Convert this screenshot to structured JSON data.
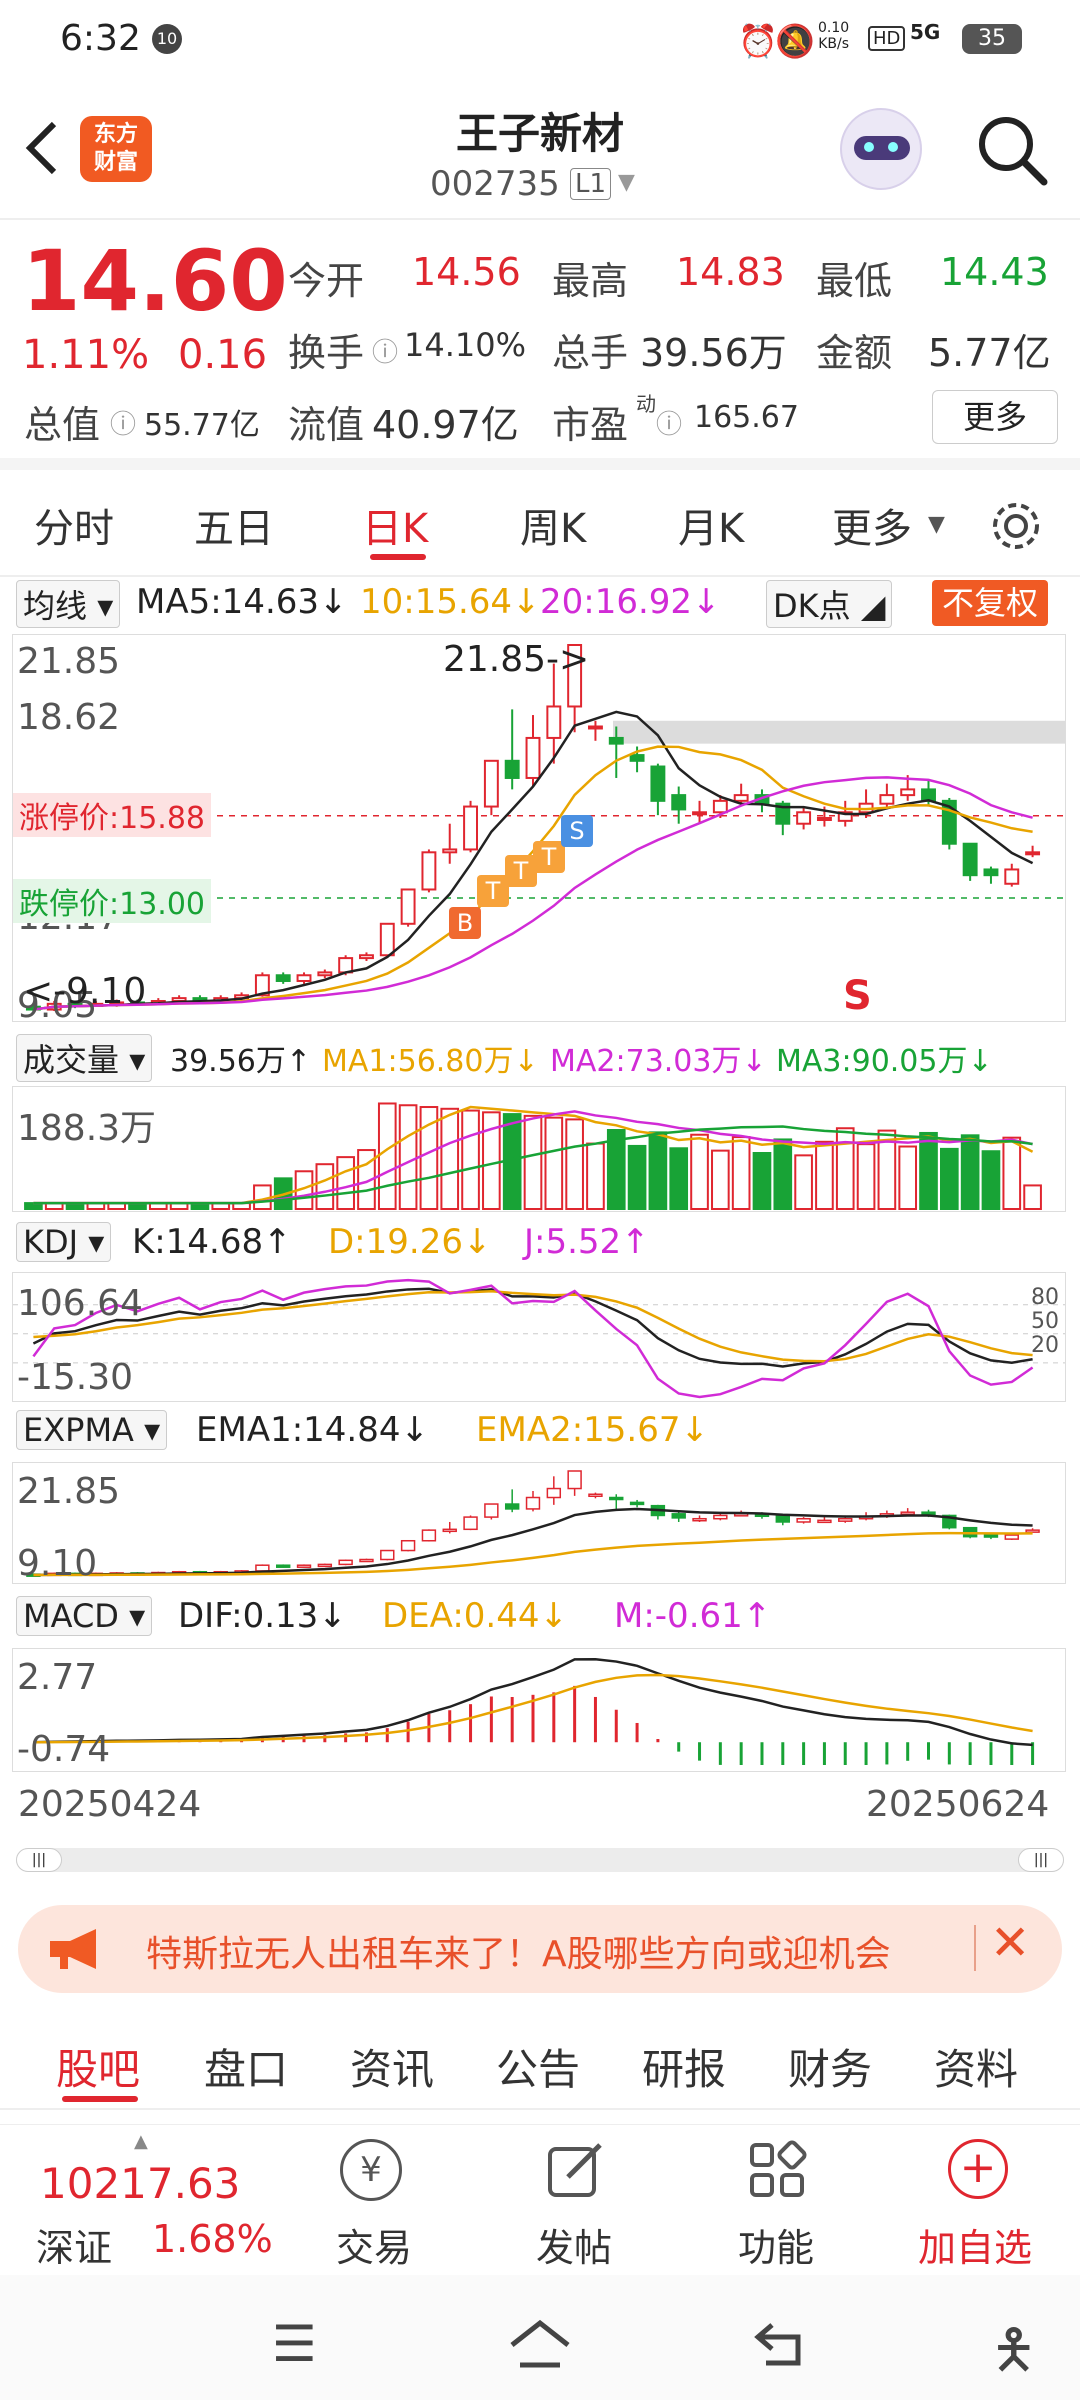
{
  "status_bar": {
    "time": "6:32",
    "notif_badge": "10",
    "net_speed": "0.10\nKB/s",
    "hd": "HD",
    "signal": "5G",
    "battery": "35"
  },
  "header": {
    "back_icon": "back-arrow-icon",
    "brand": "东方\n财富",
    "stock_name": "王子新材",
    "stock_code": "002735",
    "level": "L1",
    "search_icon": "search-icon"
  },
  "quote": {
    "price": "14.60",
    "change_pct": "1.11%",
    "change_amt": "0.16",
    "open_label": "今开",
    "open": "14.56",
    "high_label": "最高",
    "high": "14.83",
    "low_label": "最低",
    "low": "14.43",
    "turnover_label": "换手",
    "turnover": "14.10%",
    "volume_label": "总手",
    "volume": "39.56万",
    "amount_label": "金额",
    "amount": "5.77亿",
    "mktcap_label": "总值",
    "mktcap": "55.77亿",
    "float_label": "流值",
    "float": "40.97亿",
    "pe_label": "市盈",
    "pe_sup": "动",
    "pe": "165.67",
    "more_label": "更多"
  },
  "period_tabs": [
    "分时",
    "五日",
    "日K",
    "周K",
    "月K",
    "更多"
  ],
  "active_tab": "日K",
  "main_chart": {
    "ma_selector": "均线",
    "ma5": "MA5:14.63↓",
    "ma10": "10:15.64↓",
    "ma20": "20:16.92↓",
    "dk_label": "DK点",
    "fq_label": "不复权",
    "y_top": "21.85",
    "y_2": "18.62",
    "y_3": "12.17",
    "y_bottom": "9.05",
    "high_annot": "21.85->",
    "low_annot": "<-9.10",
    "limit_up": "涨停价:15.88",
    "limit_down": "跌停价:13.00",
    "s_marker": "S",
    "markers": [
      "B",
      "T",
      "T",
      "T",
      "S"
    ]
  },
  "volume_panel": {
    "selector": "成交量",
    "vol": "39.56万↑",
    "ma1": "MA1:56.80万↓",
    "ma2": "MA2:73.03万↓",
    "ma3": "MA3:90.05万↓",
    "y_top": "188.3万"
  },
  "kdj_panel": {
    "selector": "KDJ",
    "k": "K:14.68↑",
    "d": "D:19.26↓",
    "j": "J:5.52↑",
    "y_top": "106.64",
    "y_bottom": "-15.30",
    "levels": [
      "80",
      "50",
      "20"
    ]
  },
  "expma_panel": {
    "selector": "EXPMA",
    "ema1": "EMA1:14.84↓",
    "ema2": "EMA2:15.67↓",
    "y_top": "21.85",
    "y_bottom": "9.10"
  },
  "macd_panel": {
    "selector": "MACD",
    "dif": "DIF:0.13↓",
    "dea": "DEA:0.44↓",
    "m": "M:-0.61↑",
    "y_top": "2.77",
    "y_bottom": "-0.74"
  },
  "date_axis": {
    "start": "20250424",
    "end": "20250624"
  },
  "banner": {
    "text": "特斯拉无人出租车来了！A股哪些方向或迎机会",
    "close_icon": "close-icon"
  },
  "bottom_tabs": [
    "股吧",
    "盘口",
    "资讯",
    "公告",
    "研报",
    "财务",
    "资料"
  ],
  "active_bottom_tab": "股吧",
  "footer": {
    "index_value": "10217.63",
    "index_name": "深证",
    "index_change": "1.68%",
    "trade": "交易",
    "post": "发帖",
    "func": "功能",
    "add_watch": "加自选"
  },
  "colors": {
    "up": "#e0262f",
    "down": "#18a336",
    "ma10": "#e8a400",
    "ma20": "#d12bd6"
  },
  "chart_data": {
    "type": "candlestick",
    "candles": [
      {
        "o": 9.2,
        "c": 9.1,
        "h": 9.3,
        "l": 9.05
      },
      {
        "o": 9.1,
        "c": 9.3,
        "h": 9.4,
        "l": 9.05
      },
      {
        "o": 9.3,
        "c": 9.25,
        "h": 9.4,
        "l": 9.15
      },
      {
        "o": 9.25,
        "c": 9.3,
        "h": 9.4,
        "l": 9.2
      },
      {
        "o": 9.3,
        "c": 9.35,
        "h": 9.45,
        "l": 9.2
      },
      {
        "o": 9.35,
        "c": 9.3,
        "h": 9.45,
        "l": 9.25
      },
      {
        "o": 9.3,
        "c": 9.4,
        "h": 9.5,
        "l": 9.25
      },
      {
        "o": 9.4,
        "c": 9.5,
        "h": 9.6,
        "l": 9.3
      },
      {
        "o": 9.5,
        "c": 9.4,
        "h": 9.6,
        "l": 9.35
      },
      {
        "o": 9.4,
        "c": 9.5,
        "h": 9.6,
        "l": 9.35
      },
      {
        "o": 9.5,
        "c": 9.6,
        "h": 9.7,
        "l": 9.4
      },
      {
        "o": 9.6,
        "c": 10.3,
        "h": 10.4,
        "l": 9.55
      },
      {
        "o": 10.3,
        "c": 10.1,
        "h": 10.4,
        "l": 10.0
      },
      {
        "o": 10.1,
        "c": 10.3,
        "h": 10.4,
        "l": 10.0
      },
      {
        "o": 10.3,
        "c": 10.4,
        "h": 10.5,
        "l": 10.2
      },
      {
        "o": 10.4,
        "c": 10.9,
        "h": 11.0,
        "l": 10.3
      },
      {
        "o": 10.9,
        "c": 11.0,
        "h": 11.1,
        "l": 10.8
      },
      {
        "o": 11.0,
        "c": 12.1,
        "h": 12.1,
        "l": 10.9
      },
      {
        "o": 12.1,
        "c": 13.3,
        "h": 13.3,
        "l": 12.0
      },
      {
        "o": 13.3,
        "c": 14.6,
        "h": 14.7,
        "l": 13.2
      },
      {
        "o": 14.6,
        "c": 14.7,
        "h": 15.6,
        "l": 14.2
      },
      {
        "o": 14.7,
        "c": 16.2,
        "h": 16.4,
        "l": 14.6
      },
      {
        "o": 16.2,
        "c": 17.8,
        "h": 17.8,
        "l": 15.9
      },
      {
        "o": 17.8,
        "c": 17.2,
        "h": 19.6,
        "l": 16.8
      },
      {
        "o": 17.2,
        "c": 18.6,
        "h": 19.4,
        "l": 16.9
      },
      {
        "o": 18.6,
        "c": 19.7,
        "h": 21.2,
        "l": 17.7
      },
      {
        "o": 19.7,
        "c": 21.85,
        "h": 21.85,
        "l": 18.8
      },
      {
        "o": 19.0,
        "c": 19.0,
        "h": 19.2,
        "l": 18.5
      },
      {
        "o": 18.6,
        "c": 18.4,
        "h": 19.0,
        "l": 17.2
      },
      {
        "o": 18.0,
        "c": 17.8,
        "h": 18.3,
        "l": 17.4
      },
      {
        "o": 17.6,
        "c": 16.4,
        "h": 17.7,
        "l": 15.9
      },
      {
        "o": 16.6,
        "c": 16.1,
        "h": 16.9,
        "l": 15.6
      },
      {
        "o": 16.0,
        "c": 16.0,
        "h": 16.4,
        "l": 15.6
      },
      {
        "o": 16.0,
        "c": 16.4,
        "h": 16.6,
        "l": 15.8
      },
      {
        "o": 16.4,
        "c": 16.6,
        "h": 17.0,
        "l": 16.3
      },
      {
        "o": 16.6,
        "c": 16.3,
        "h": 16.8,
        "l": 16.0
      },
      {
        "o": 16.3,
        "c": 15.6,
        "h": 16.4,
        "l": 15.2
      },
      {
        "o": 15.6,
        "c": 16.0,
        "h": 16.2,
        "l": 15.4
      },
      {
        "o": 15.8,
        "c": 15.8,
        "h": 16.2,
        "l": 15.5
      },
      {
        "o": 15.7,
        "c": 16.0,
        "h": 16.4,
        "l": 15.5
      },
      {
        "o": 16.0,
        "c": 16.3,
        "h": 16.8,
        "l": 15.8
      },
      {
        "o": 16.3,
        "c": 16.6,
        "h": 17.0,
        "l": 16.1
      },
      {
        "o": 16.6,
        "c": 16.8,
        "h": 17.3,
        "l": 16.4
      },
      {
        "o": 16.8,
        "c": 16.4,
        "h": 17.1,
        "l": 16.2
      },
      {
        "o": 16.4,
        "c": 14.9,
        "h": 16.5,
        "l": 14.7
      },
      {
        "o": 14.9,
        "c": 13.8,
        "h": 14.9,
        "l": 13.6
      },
      {
        "o": 14.0,
        "c": 13.8,
        "h": 14.1,
        "l": 13.5
      },
      {
        "o": 13.5,
        "c": 14.0,
        "h": 14.2,
        "l": 13.4
      },
      {
        "o": 14.56,
        "c": 14.6,
        "h": 14.83,
        "l": 14.43
      }
    ]
  }
}
